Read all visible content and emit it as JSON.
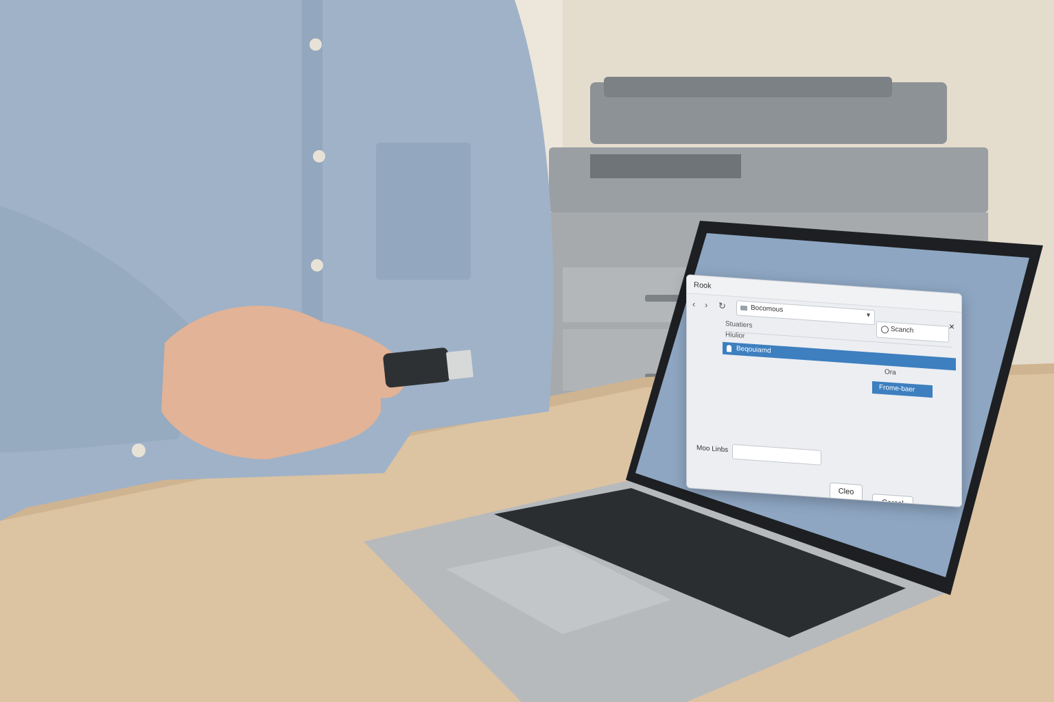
{
  "dialog": {
    "title": "Rook",
    "close_glyph": "×",
    "nav_back": "‹",
    "nav_forward": "›",
    "nav_refresh": "↻",
    "path": "Bocomous",
    "path_caret": "▾",
    "search_placeholder": "Scanch",
    "column_header": "Stuatiers",
    "group_label": "Hiulior",
    "selected_row": "Beqouiamd",
    "other_row": "Ora",
    "selected_row_2": "Frome-baer",
    "filename_label": "Moo Linbs",
    "buttons": {
      "open": "Cleo",
      "cancel": "Corcol"
    }
  },
  "colors": {
    "accent": "#3d7fbf",
    "screen": "#8ea6c2",
    "shirt": "#9fb2c8",
    "desk": "#d8c1a1",
    "wall": "#e9e2d6"
  },
  "icons": [
    "back-icon",
    "forward-icon",
    "refresh-icon",
    "folder-icon",
    "search-icon",
    "close-icon",
    "usb-drive-icon"
  ]
}
